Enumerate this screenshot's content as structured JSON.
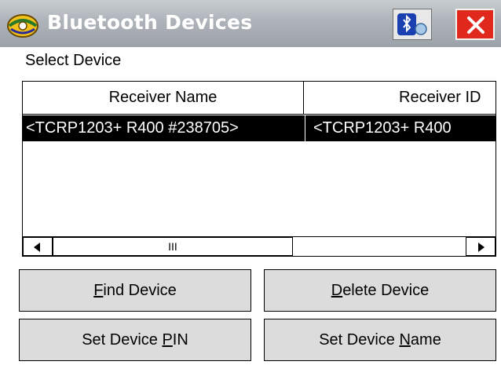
{
  "window": {
    "title": "Bluetooth Devices",
    "icons": [
      "app-icon",
      "bluetooth-icon",
      "close-icon"
    ],
    "close_color": "#e0281c"
  },
  "select_label": "Select Device",
  "list": {
    "columns": [
      "Receiver Name",
      "Receiver ID"
    ],
    "rows": [
      [
        "<TCRP1203+ R400 #238705>",
        "<TCRP1203+ R400"
      ]
    ],
    "selected_row": 0
  },
  "scrollbar": {
    "thumb_glyph": "III",
    "left_icon": "arrow-left-icon",
    "right_icon": "arrow-right-icon"
  },
  "buttons": {
    "find": {
      "pre": "",
      "key": "F",
      "post": "ind Device"
    },
    "delete": {
      "pre": "",
      "key": "D",
      "post": "elete Device"
    },
    "set_pin": {
      "pre": "Set Device ",
      "key": "P",
      "post": "IN"
    },
    "set_name": {
      "pre": "Set Device ",
      "key": "N",
      "post": "ame"
    }
  }
}
